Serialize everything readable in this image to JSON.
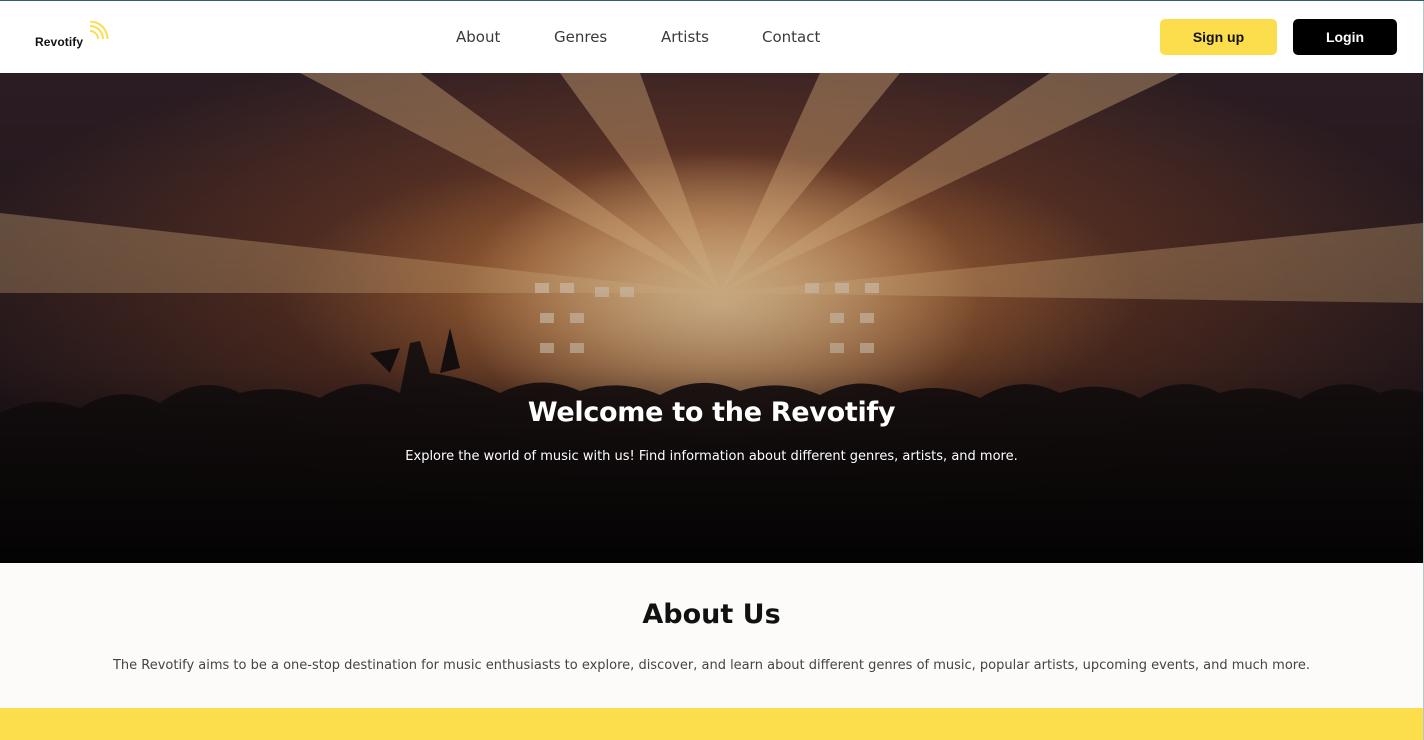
{
  "brand": {
    "name": "Revotify",
    "accent": "#fcde4d"
  },
  "nav": {
    "links": [
      "About",
      "Genres",
      "Artists",
      "Contact"
    ],
    "signup_label": "Sign up",
    "login_label": "Login"
  },
  "hero": {
    "title": "Welcome to the Revotify",
    "subtitle": "Explore the world of music with us! Find information about different genres, artists, and more."
  },
  "about": {
    "title": "About Us",
    "text": "The Revotify aims to be a one-stop destination for music enthusiasts to explore, discover, and learn about different genres of music, popular artists, upcoming events, and much more."
  },
  "colors": {
    "accent": "#fcde4d",
    "dark": "#000000",
    "about_bg": "#fcfbf9"
  }
}
